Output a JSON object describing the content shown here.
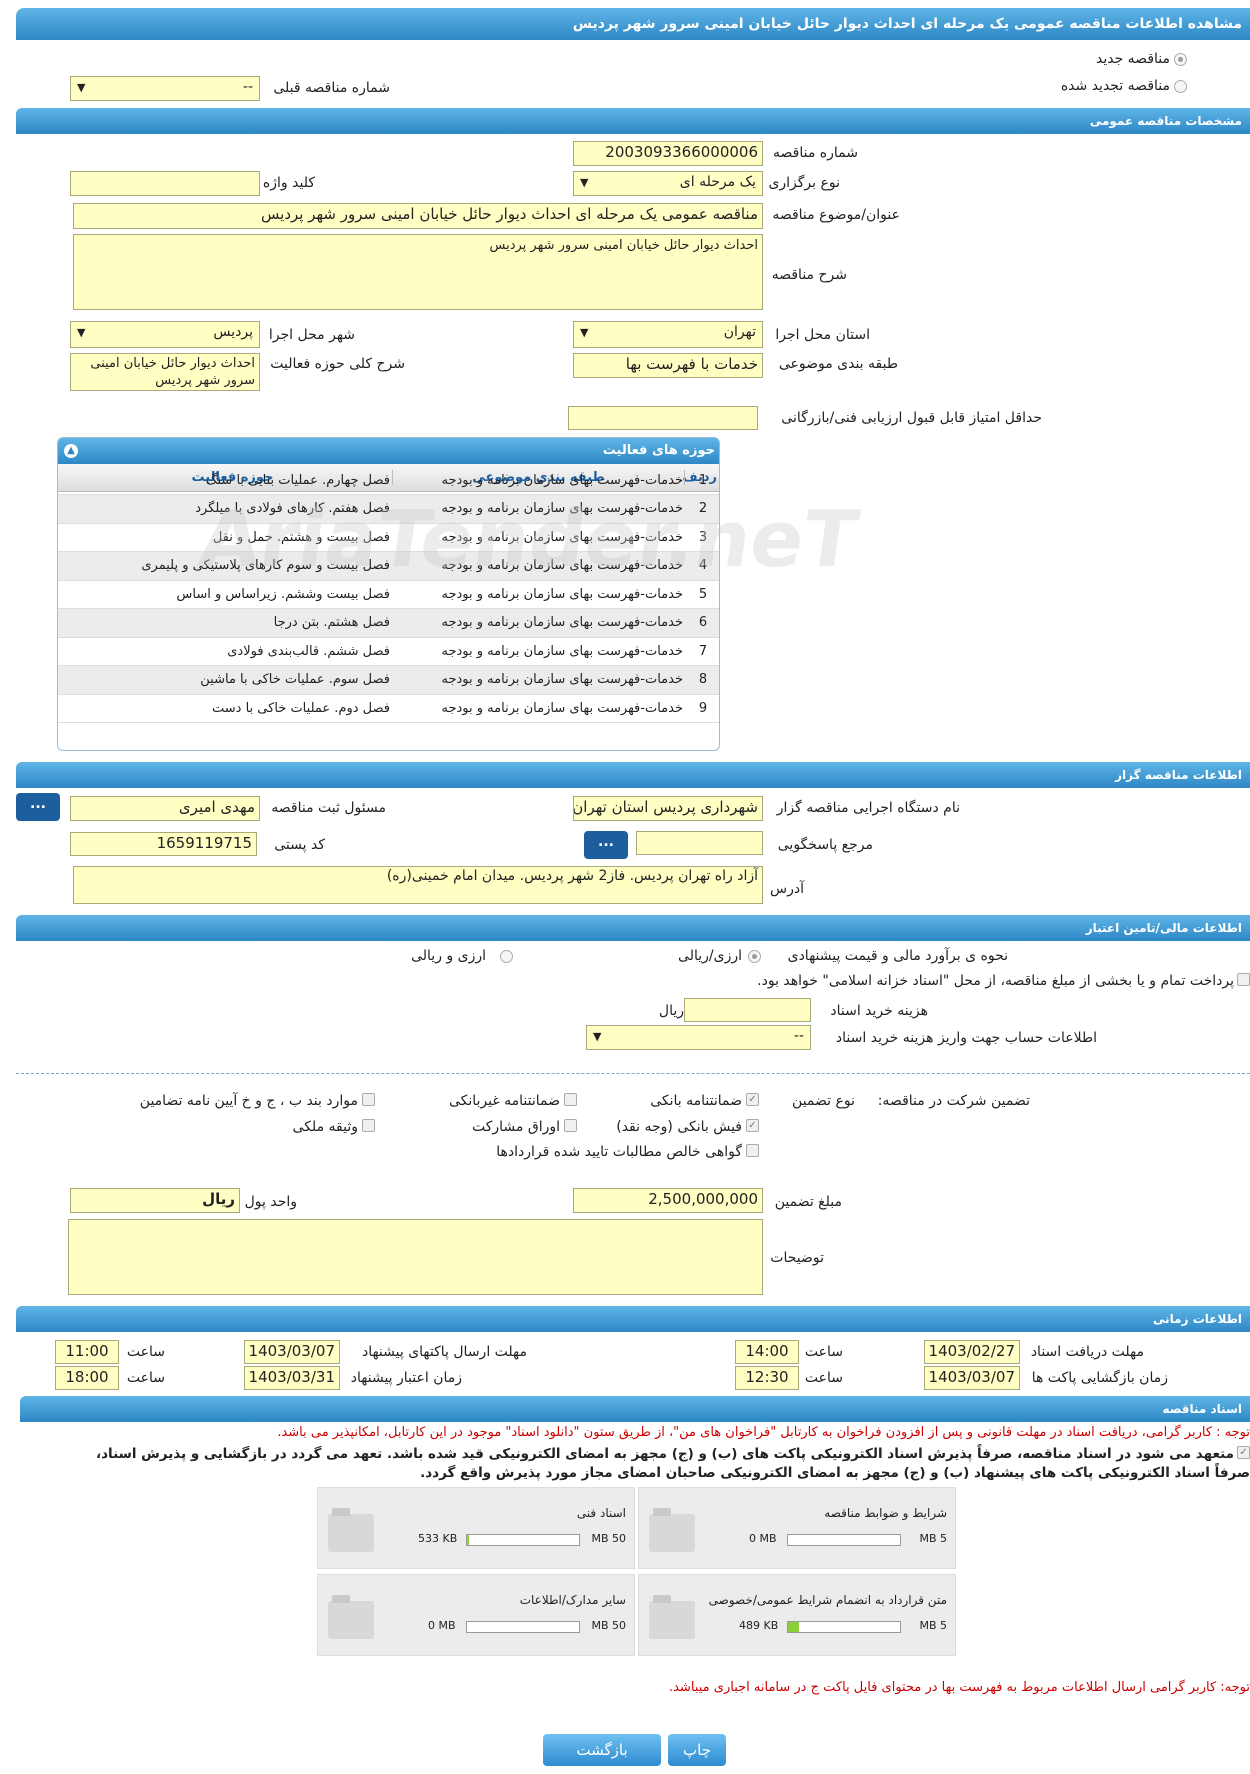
{
  "page_title": "مشاهده اطلاعات مناقصه عمومی یک مرحله ای احداث دیوار حائل خیابان امینی سرور شهر پردیس",
  "top": {
    "new_tender": "مناقصه جدید",
    "renewed_tender": "مناقصه تجدید شده",
    "prev_number_label": "شماره مناقصه قبلی",
    "prev_number_value": "--"
  },
  "general": {
    "section_title": "مشخصات مناقصه عمومی",
    "number_label": "شماره مناقصه",
    "number_value": "2003093366000006",
    "type_label": "نوع برگزاری",
    "type_value": "یک مرحله ای",
    "keyword_label": "کلید واژه",
    "keyword_value": "",
    "subject_label": "عنوان/موضوع مناقصه",
    "subject_value": "مناقصه عمومی یک مرحله ای احداث دیوار حائل خیابان امینی سرور شهر پردیس",
    "desc_label": "شرح مناقصه",
    "desc_value": "احداث دیوار حائل خیابان امینی سرور شهر پردیس",
    "province_label": "استان محل اجرا",
    "province_value": "تهران",
    "city_label": "شهر محل اجرا",
    "city_value": "پردیس",
    "category_label": "طبقه بندی موضوعی",
    "category_value": "خدمات با فهرست بها",
    "scope_label": "شرح کلی حوزه فعالیت",
    "scope_value": "احداث دیوار حائل خیابان امینی سرور شهر پردیس",
    "min_score_label": "حداقل امتیاز قابل قبول ارزیابی فنی/بازرگانی",
    "min_score_value": ""
  },
  "activities": {
    "title": "حوزه های فعالیت",
    "col_row": "ردیف",
    "col_category": "طبقه بندی موضوعی",
    "col_activity": "حوزه فعالیت",
    "rows": [
      {
        "n": "1",
        "cat": "خدمات-فهرست بهای سازمان برنامه و بودجه",
        "act": "فصل چهارم. عملیات بنایی با سنگ"
      },
      {
        "n": "2",
        "cat": "خدمات-فهرست بهای سازمان برنامه و بودجه",
        "act": "فصل هفتم. کارهای فولادی با میلگرد"
      },
      {
        "n": "3",
        "cat": "خدمات-فهرست بهای سازمان برنامه و بودجه",
        "act": "فصل بیست و هشتم. حمل و نقل"
      },
      {
        "n": "4",
        "cat": "خدمات-فهرست بهای سازمان برنامه و بودجه",
        "act": "فصل بیست و سوم کارهای پلاستیکی و پلیمری"
      },
      {
        "n": "5",
        "cat": "خدمات-فهرست بهای سازمان برنامه و بودجه",
        "act": "فصل بیست وششم. زیراساس و اساس"
      },
      {
        "n": "6",
        "cat": "خدمات-فهرست بهای سازمان برنامه و بودجه",
        "act": "فصل هشتم. بتن درجا"
      },
      {
        "n": "7",
        "cat": "خدمات-فهرست بهای سازمان برنامه و بودجه",
        "act": "فصل ششم. قالب‌بندی فولادی"
      },
      {
        "n": "8",
        "cat": "خدمات-فهرست بهای سازمان برنامه و بودجه",
        "act": "فصل سوم. عملیات خاکی با ماشین"
      },
      {
        "n": "9",
        "cat": "خدمات-فهرست بهای سازمان برنامه و بودجه",
        "act": "فصل دوم. عملیات خاکی با دست"
      }
    ]
  },
  "organizer": {
    "section_title": "اطلاعات مناقصه گزار",
    "org_label": "نام دستگاه اجرایی مناقصه گزار",
    "org_value": "شهرداری پردیس استان تهران",
    "resp_label": "مسئول ثبت مناقصه",
    "resp_value": "مهدی امیری",
    "ref_label": "مرجع پاسخگویی",
    "ref_value": "",
    "postal_label": "کد پستی",
    "postal_value": "1659119715",
    "address_label": "آدرس",
    "address_value": "آزاد راه تهران پردیس. فاز2 شهر پردیس. میدان امام خمینی(ره)",
    "dots": "..."
  },
  "finance": {
    "section_title": "اطلاعات مالی/تامین اعتبار",
    "method_label": "نحوه ی برآورد مالی و قیمت پیشنهادی",
    "opt_rial": "ارزی/ریالی",
    "opt_fx": "ارزی و ریالی",
    "treasury_text": "پرداخت تمام و یا بخشی از مبلغ مناقصه، از محل \"اسناد خزانه اسلامی\" خواهد بود.",
    "doc_cost_label": "هزینه خرید اسناد",
    "doc_cost_value": "",
    "doc_cost_unit": "ریال",
    "account_label": "اطلاعات حساب جهت واریز هزینه خرید اسناد",
    "account_value": "--"
  },
  "guarantee": {
    "label": "تضمین شرکت در مناقصه:",
    "type_label": "نوع تضمین",
    "bank_guarantee": "ضمانتنامه بانکی",
    "non_bank_guarantee": "ضمانتنامه غیربانکی",
    "other_items": "موارد بند ب ، ج و خ آیین نامه تضامین",
    "cash_receipt": "فیش بانکی (وجه نقد)",
    "bonds": "اوراق مشارکت",
    "property": "وثیقه ملکی",
    "claims": "گواهی خالص مطالبات تایید شده قراردادها",
    "amount_label": "مبلغ تضمین",
    "amount_value": "2,500,000,000",
    "currency_label": "واحد پول",
    "currency_value": "ریال",
    "notes_label": "توضیحات",
    "notes_value": ""
  },
  "timing": {
    "section_title": "اطلاعات زمانی",
    "receive_label": "مهلت دریافت اسناد",
    "receive_date": "1403/02/27",
    "receive_time": "14:00",
    "send_label": "مهلت ارسال پاکتهای پیشنهاد",
    "send_date": "1403/03/07",
    "send_time": "11:00",
    "open_label": "زمان بازگشایی پاکت ها",
    "open_date": "1403/03/07",
    "open_time": "12:30",
    "valid_label": "زمان اعتبار پیشنهاد",
    "valid_date": "1403/03/31",
    "valid_time": "18:00",
    "time_label": "ساعت"
  },
  "documents": {
    "section_title": "اسناد مناقصه",
    "note1": "توجه : کاربر گرامی، دریافت اسناد در مهلت قانونی و پس از افزودن فراخوان به کارتابل \"فراخوان های من\"، از طریق ستون \"دانلود اسناد\" موجود در این کارتابل، امکانپذیر می باشد.",
    "commit_line1": "متعهد می شود در اسناد مناقصه، صرفاً پذیرش اسناد الکترونیکی پاکت های (ب) و (ج) مجهز به امضای الکترونیکی قید شده باشد. تعهد می گردد در بازگشایی و پذیرش اسناد،",
    "commit_line2": "صرفاً اسناد الکترونیکی پاکت های پیشنهاد (ب) و (ج) مجهز به امضای الکترونیکی صاحبان امضای مجاز مورد پذیرش واقع گردد.",
    "files": [
      {
        "name": "شرایط و ضوابط مناقصه",
        "used": "0 MB",
        "max": "5 MB",
        "fill": 0
      },
      {
        "name": "اسناد فنی",
        "used": "533 KB",
        "max": "50 MB",
        "fill": 0.01
      },
      {
        "name": "متن قرارداد به انضمام شرایط عمومی/خصوصی",
        "used": "489 KB",
        "max": "5 MB",
        "fill": 0.1
      },
      {
        "name": "سایر مدارک/اطلاعات",
        "used": "0 MB",
        "max": "50 MB",
        "fill": 0
      }
    ],
    "note2": "توجه: کاربر گرامی ارسال اطلاعات مربوط به فهرست بها در محتوای فایل پاکت ج در سامانه اجباری میباشد."
  },
  "actions": {
    "print": "چاپ",
    "back": "بازگشت"
  },
  "watermark": "AriaTender.neT"
}
